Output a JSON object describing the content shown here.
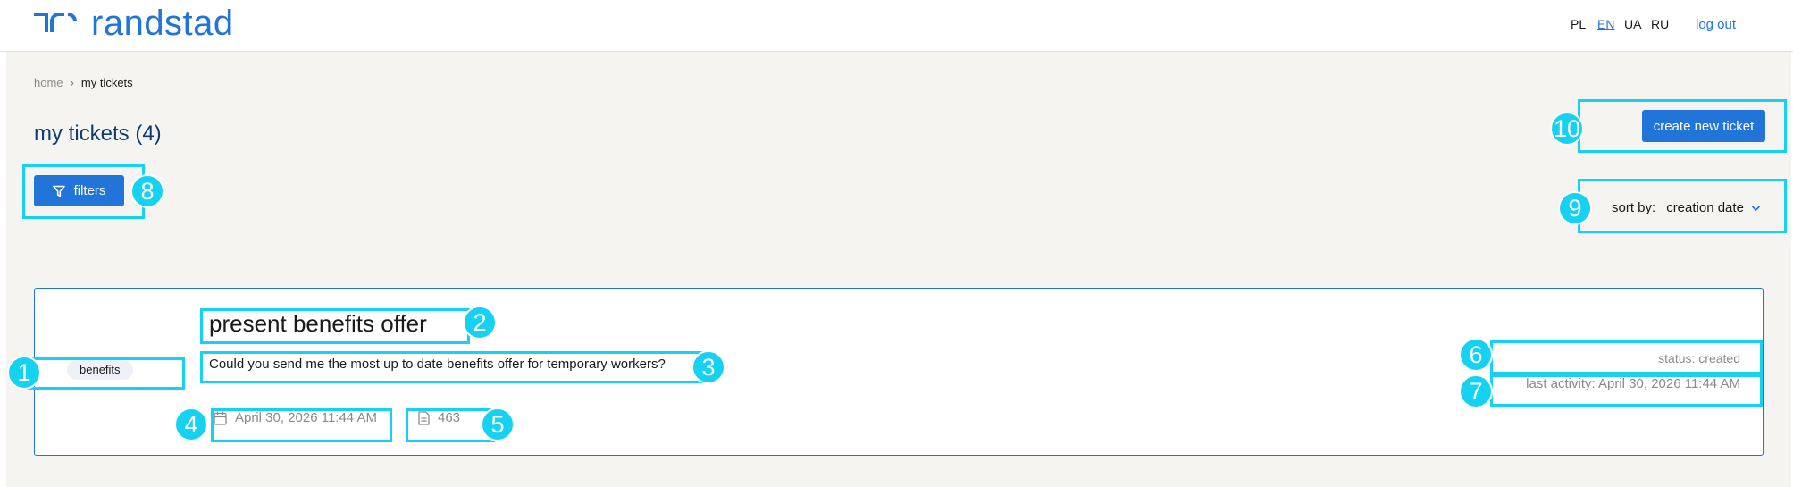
{
  "header": {
    "logo_text": "randstad",
    "languages": [
      {
        "code": "PL",
        "active": false
      },
      {
        "code": "EN",
        "active": true
      },
      {
        "code": "UA",
        "active": false
      },
      {
        "code": "RU",
        "active": false
      }
    ],
    "logout_label": "log out"
  },
  "breadcrumb": {
    "home": "home",
    "separator": "›",
    "current": "my tickets"
  },
  "page": {
    "title": "my tickets (4)",
    "filters_label": "filters",
    "create_label": "create new ticket",
    "sort_label": "sort by:",
    "sort_value": "creation date"
  },
  "ticket": {
    "tag": "benefits",
    "title": "present benefits offer",
    "description": "Could you send me the most up to date benefits offer for temporary workers?",
    "created": "April 30, 2026 11:44 AM",
    "doc_count": "463",
    "status": "status: created",
    "last_activity": "last activity: April 30, 2026 11:44 AM"
  },
  "annotations": {
    "labels": [
      "1",
      "2",
      "3",
      "4",
      "5",
      "6",
      "7",
      "8",
      "9",
      "10"
    ]
  },
  "colors": {
    "brand": "#2175d9",
    "title": "#0f3d73",
    "background": "#f5f4f0",
    "annotation": "#16d2f2",
    "muted": "#8a8a8a"
  }
}
